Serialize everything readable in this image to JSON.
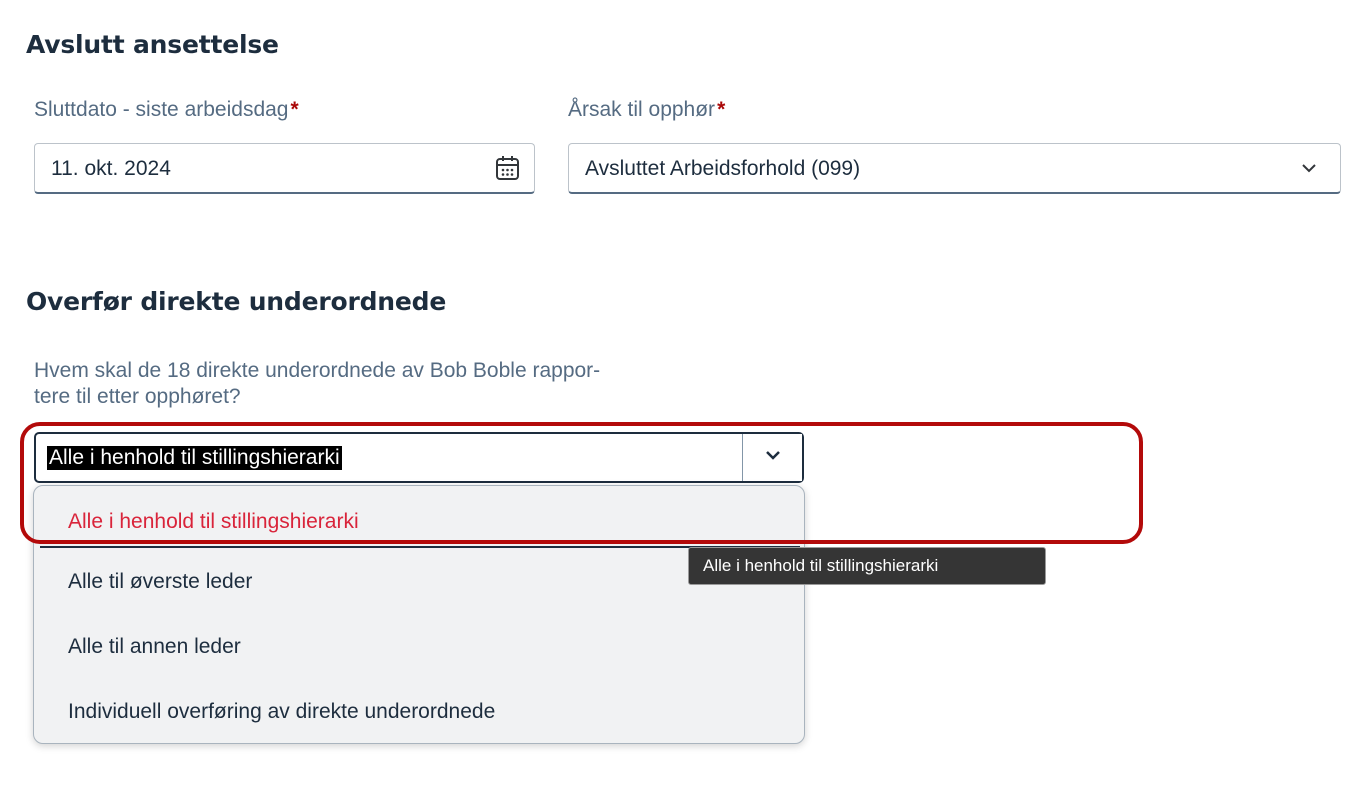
{
  "termination": {
    "title": "Avslutt ansettelse",
    "end_date": {
      "label": "Sluttdato - siste arbeidsdag",
      "required_mark": "*",
      "value": "11. okt. 2024",
      "icon": "calendar-icon"
    },
    "reason": {
      "label": "Årsak til opphør",
      "required_mark": "*",
      "value": "Avsluttet Arbeidsforhold (099)",
      "icon": "chevron-down-icon"
    }
  },
  "transfer": {
    "title": "Overfør direkte underordnede",
    "question_line1": "Hvem skal de 18 direkte underordnede av Bob Boble rappor-",
    "question_line2": "tere til etter opphøret?",
    "combo_value": "Alle i henhold til stillingshierarki",
    "options": [
      "Alle i henhold til stillingshierarki",
      "Alle til øverste leder",
      "Alle til annen leder",
      "Individuell overføring av direkte underordnede"
    ],
    "selected_index": 0,
    "tooltip": "Alle i henhold til stillingshierarki"
  },
  "colors": {
    "required": "#aa0808",
    "selected_option": "#d9243a",
    "highlight": "#b30a0a"
  }
}
